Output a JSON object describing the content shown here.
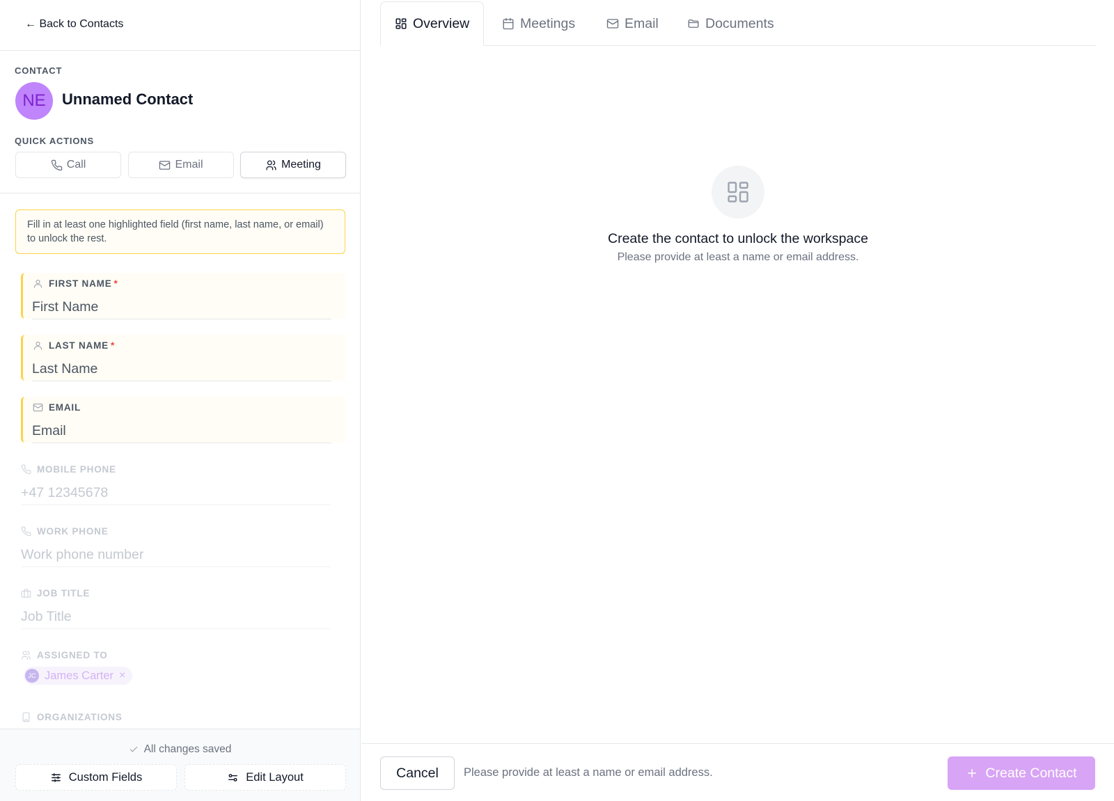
{
  "nav": {
    "back_label": "← Back to Contacts"
  },
  "contact": {
    "section_label": "CONTACT",
    "initials": "NE",
    "name": "Unnamed Contact"
  },
  "quick_actions": {
    "section_label": "QUICK ACTIONS",
    "call_label": "Call",
    "email_label": "Email",
    "meeting_label": "Meeting"
  },
  "notice": {
    "text": "Fill in at least one highlighted field (first name, last name, or email) to unlock the rest."
  },
  "fields": {
    "first_name": {
      "label": "FIRST NAME",
      "required_mark": "*",
      "placeholder": "First Name"
    },
    "last_name": {
      "label": "LAST NAME",
      "required_mark": "*",
      "placeholder": "Last Name"
    },
    "email": {
      "label": "EMAIL",
      "placeholder": "Email"
    },
    "mobile_phone": {
      "label": "MOBILE PHONE",
      "placeholder": "+47 12345678"
    },
    "work_phone": {
      "label": "WORK PHONE",
      "placeholder": "Work phone number"
    },
    "job_title": {
      "label": "JOB TITLE",
      "placeholder": "Job Title"
    },
    "assigned_to": {
      "label": "ASSIGNED TO",
      "assignee_initials": "JC",
      "assignee_name": "James Carter",
      "remove_glyph": "×"
    },
    "organizations": {
      "label": "ORGANIZATIONS"
    }
  },
  "left_footer": {
    "status": "All changes saved",
    "custom_fields_label": "Custom Fields",
    "edit_layout_label": "Edit Layout"
  },
  "tabs": {
    "overview": "Overview",
    "meetings": "Meetings",
    "email": "Email",
    "documents": "Documents",
    "active": "Overview"
  },
  "empty_state": {
    "title": "Create the contact to unlock the workspace",
    "subtitle": "Please provide at least a name or email address."
  },
  "right_footer": {
    "cancel_label": "Cancel",
    "message": "Please provide at least a name or email address.",
    "create_label": "Create Contact"
  },
  "colors": {
    "accent": "#d8a4f5",
    "avatar_bg": "#c084fc",
    "highlight_border": "#fcd34d",
    "required": "#ef4444"
  }
}
